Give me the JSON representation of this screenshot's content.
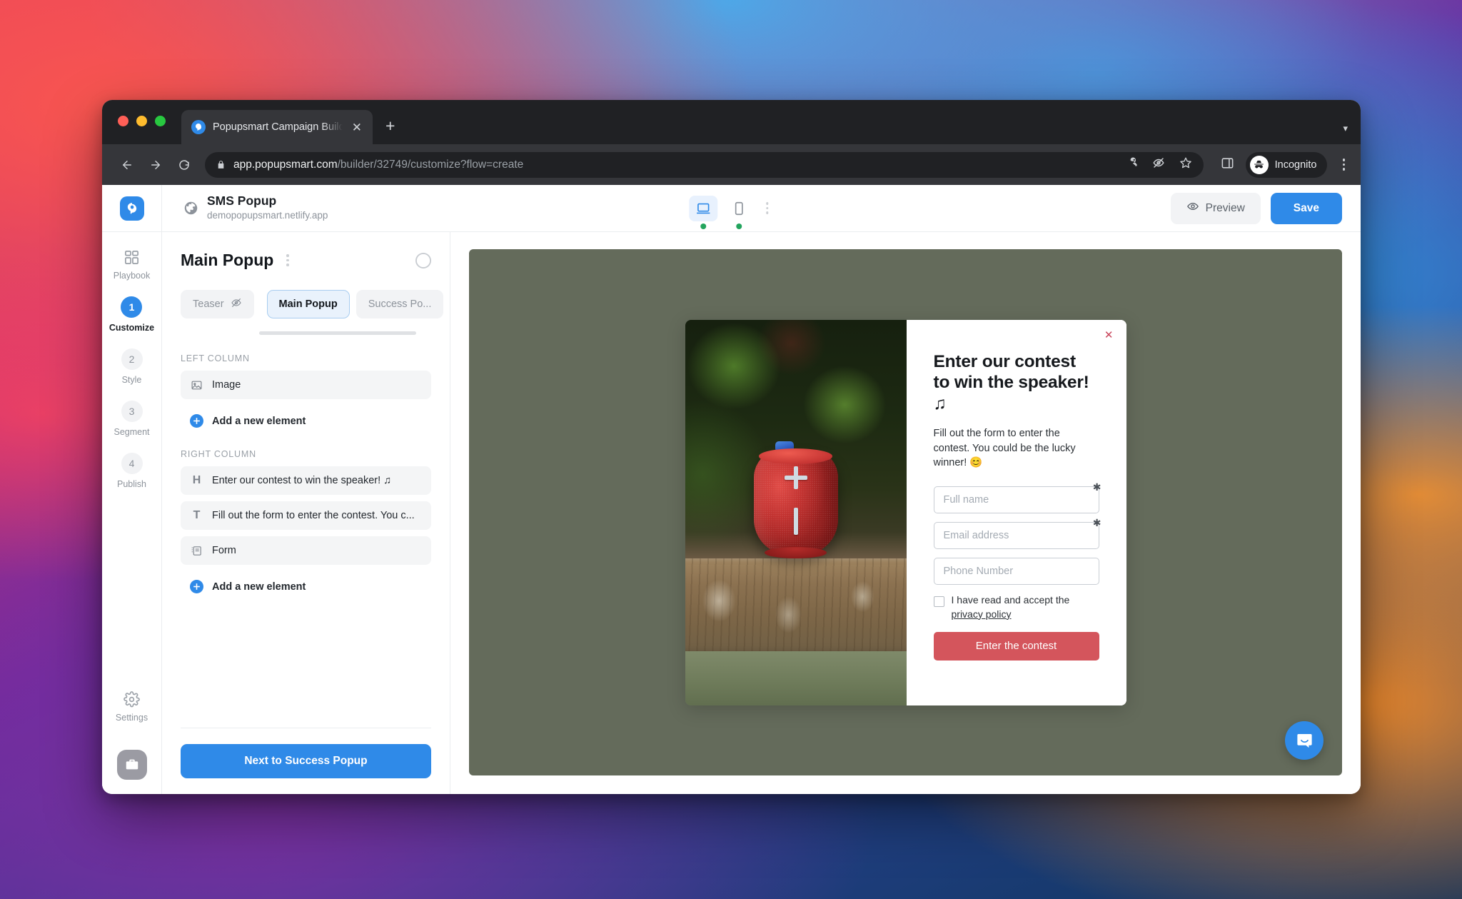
{
  "browser": {
    "tab": {
      "title": "Popupsmart Campaign Builder",
      "favicon_icon": "popupsmart-logo-icon",
      "close_icon": "close-icon"
    },
    "new_tab_icon": "plus-icon",
    "tab_list_icon": "chevron-down-icon",
    "nav": {
      "back_icon": "arrow-left-icon",
      "forward_icon": "arrow-right-icon",
      "reload_icon": "reload-icon"
    },
    "url": {
      "lock_icon": "lock-icon",
      "domain": "app.popupsmart.com",
      "path": "/builder/32749/customize?flow=create"
    },
    "omni_icons": [
      "key-icon",
      "eye-off-icon",
      "star-icon"
    ],
    "side_panel_icon": "side-panel-icon",
    "profile": {
      "label": "Incognito",
      "icon": "incognito-icon"
    },
    "menu_icon": "kebab-menu-icon"
  },
  "header": {
    "logo_icon": "popupsmart-logo-icon",
    "globe_icon": "globe-icon",
    "campaign_name": "SMS Popup",
    "campaign_url": "demopopupsmart.netlify.app",
    "devices": [
      {
        "name": "desktop",
        "icon": "desktop-icon",
        "active": true,
        "status": "on"
      },
      {
        "name": "mobile",
        "icon": "mobile-icon",
        "active": false,
        "status": "on"
      }
    ],
    "device_more_icon": "kebab-menu-icon",
    "preview_label": "Preview",
    "preview_icon": "eye-icon",
    "save_label": "Save"
  },
  "rail": {
    "items": [
      {
        "label": "Playbook",
        "icon": "grid-icon",
        "num": "",
        "active": false
      },
      {
        "label": "Customize",
        "icon": "",
        "num": "1",
        "active": true
      },
      {
        "label": "Style",
        "icon": "",
        "num": "2",
        "active": false
      },
      {
        "label": "Segment",
        "icon": "",
        "num": "3",
        "active": false
      },
      {
        "label": "Publish",
        "icon": "",
        "num": "4",
        "active": false
      }
    ],
    "settings": {
      "label": "Settings",
      "icon": "gear-icon"
    },
    "toolbox_icon": "toolbox-icon"
  },
  "panel": {
    "title": "Main Popup",
    "more_icon": "kebab-menu-icon",
    "add_icon": "plus-circle-icon",
    "tabs": [
      {
        "label": "Teaser",
        "icon": "eye-off-icon",
        "active": false
      },
      {
        "label": "Main Popup",
        "icon": "",
        "active": true
      },
      {
        "label": "Success Po...",
        "icon": "",
        "active": false
      }
    ],
    "left_column": {
      "label": "LEFT COLUMN",
      "elements": [
        {
          "icon": "image-icon",
          "label": "Image"
        }
      ],
      "add_label": "Add a new element"
    },
    "right_column": {
      "label": "RIGHT COLUMN",
      "elements": [
        {
          "icon": "heading-icon",
          "label": "Enter our contest to win the speaker! ♫"
        },
        {
          "icon": "text-icon",
          "label": "Fill out the form to enter the contest. You c..."
        },
        {
          "icon": "form-icon",
          "label": "Form"
        }
      ],
      "add_label": "Add a new element"
    },
    "next_label": "Next to Success Popup"
  },
  "canvas": {
    "background_color": "#646b5b",
    "popup": {
      "close_icon": "close-icon",
      "image_alt": "red-bluetooth-speaker-on-wooden-bench",
      "heading_line1": "Enter our contest",
      "heading_line2": "to win the speaker! ♫",
      "body": "Fill out the form to enter the contest. You could be the lucky winner! 😊",
      "fields": [
        {
          "placeholder": "Full name",
          "value": "",
          "required": true
        },
        {
          "placeholder": "Email address",
          "value": "",
          "required": true
        },
        {
          "placeholder": "Phone Number",
          "value": "",
          "required": false
        }
      ],
      "consent_text": "I have read and accept the",
      "consent_link": "privacy policy",
      "submit_label": "Enter the contest",
      "submit_color": "#d4555c"
    },
    "intercom_icon": "chat-bubble-icon"
  }
}
